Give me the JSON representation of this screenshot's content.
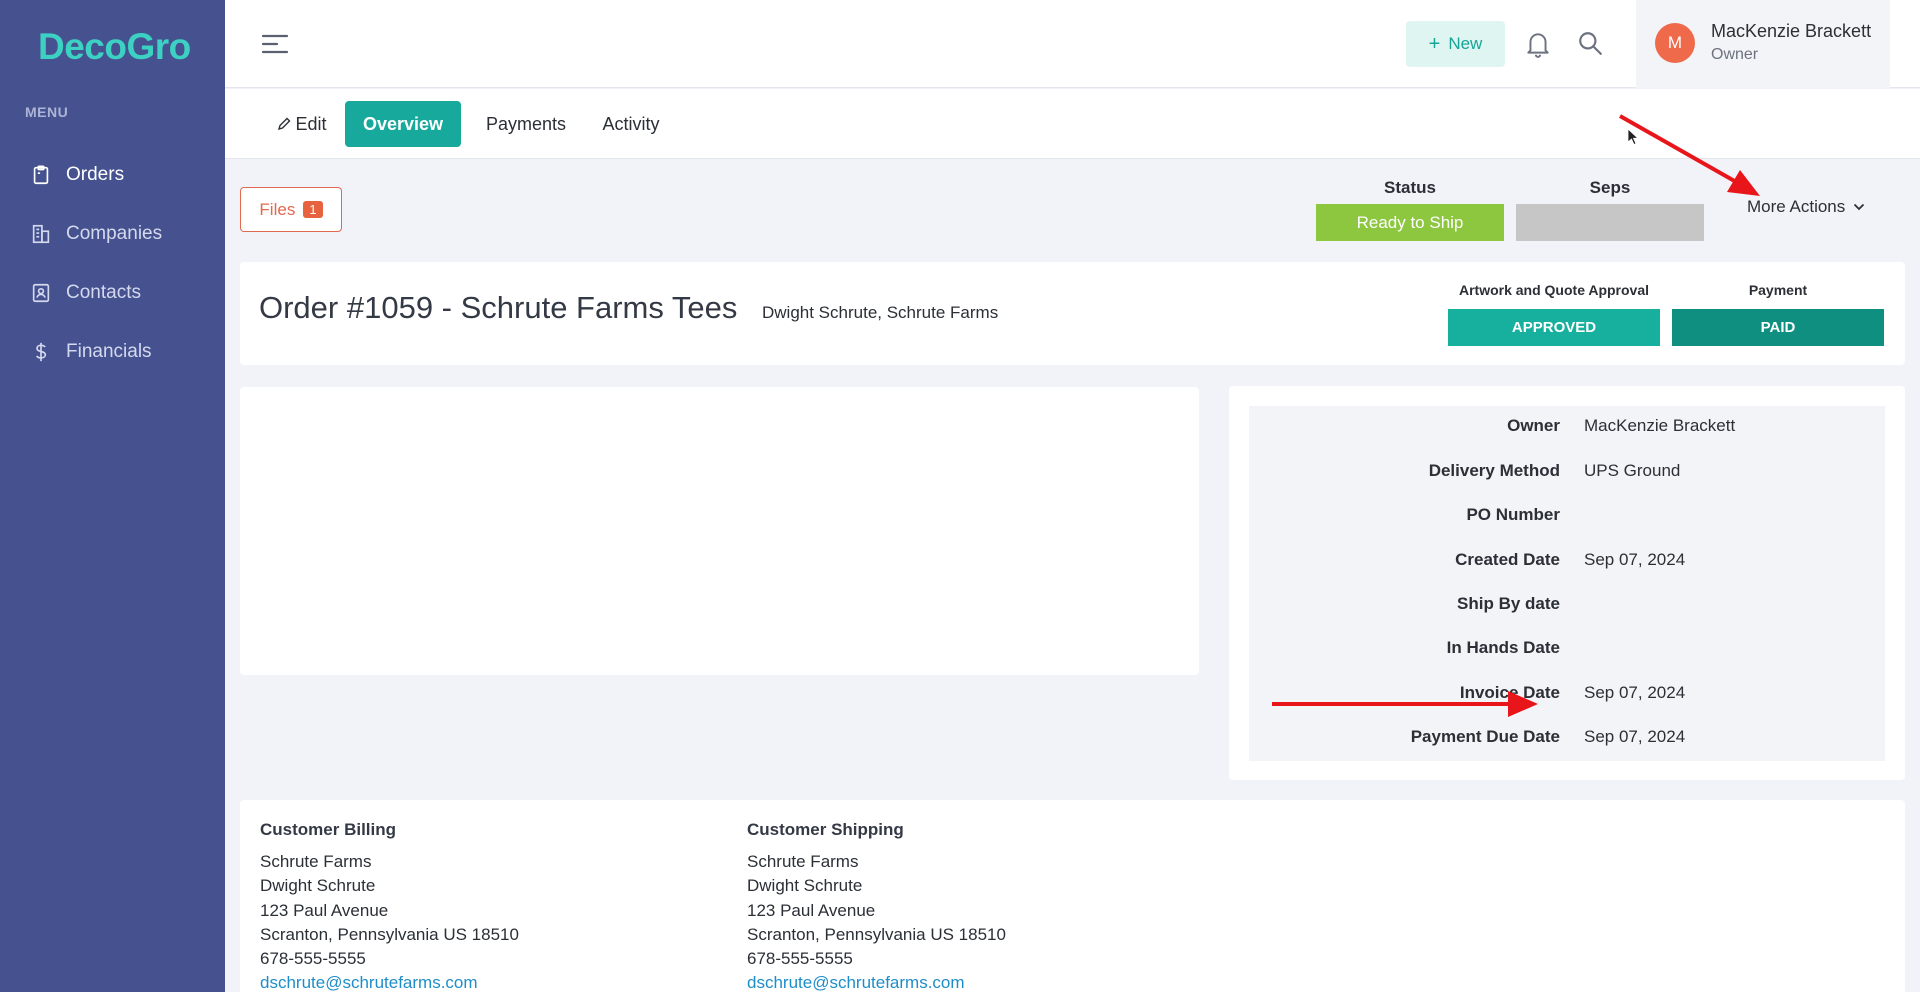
{
  "app": {
    "logo": "DecoGro"
  },
  "sidebar": {
    "menu_label": "MENU",
    "items": [
      {
        "label": "Orders",
        "icon": "clipboard-icon"
      },
      {
        "label": "Companies",
        "icon": "building-icon"
      },
      {
        "label": "Contacts",
        "icon": "contact-card-icon"
      },
      {
        "label": "Financials",
        "icon": "dollar-icon"
      }
    ]
  },
  "topbar": {
    "new_label": "New",
    "user": {
      "initial": "M",
      "name": "MacKenzie Brackett",
      "role": "Owner"
    }
  },
  "tabs": [
    {
      "label": "Edit"
    },
    {
      "label": "Overview"
    },
    {
      "label": "Payments"
    },
    {
      "label": "Activity"
    }
  ],
  "actions": {
    "files_label": "Files",
    "files_count": "1",
    "status_label": "Status",
    "status_value": "Ready to Ship",
    "seps_label": "Seps",
    "seps_value": "",
    "more_actions_label": "More Actions"
  },
  "order": {
    "title": "Order #1059 - Schrute Farms Tees",
    "subtitle": "Dwight Schrute, Schrute Farms",
    "approval_label": "Artwork and Quote Approval",
    "approval_value": "APPROVED",
    "payment_label": "Payment",
    "payment_value": "PAID"
  },
  "details": [
    {
      "label": "Owner",
      "value": "MacKenzie Brackett"
    },
    {
      "label": "Delivery Method",
      "value": "UPS Ground"
    },
    {
      "label": "PO Number",
      "value": ""
    },
    {
      "label": "Created Date",
      "value": "Sep 07, 2024"
    },
    {
      "label": "Ship By date",
      "value": ""
    },
    {
      "label": "In Hands Date",
      "value": ""
    },
    {
      "label": "Invoice Date",
      "value": "Sep 07, 2024"
    },
    {
      "label": "Payment Due Date",
      "value": "Sep 07, 2024"
    }
  ],
  "billing": {
    "title": "Customer Billing",
    "lines": [
      "Schrute Farms",
      "Dwight Schrute",
      "123 Paul Avenue",
      "Scranton, Pennsylvania US 18510",
      "678-555-5555"
    ],
    "email": "dschrute@schrutefarms.com"
  },
  "shipping": {
    "title": "Customer Shipping",
    "lines": [
      "Schrute Farms",
      "Dwight Schrute",
      "123 Paul Avenue",
      "Scranton, Pennsylvania US 18510",
      "678-555-5555"
    ],
    "email": "dschrute@schrutefarms.com"
  },
  "colors": {
    "sidebar": "#45528f",
    "accent_teal": "#17a99b",
    "status_green": "#8dc63f",
    "seps_gray": "#c6c6c6",
    "approved": "#17b09f",
    "paid": "#0e8f80",
    "annotation_red": "#e8161b"
  }
}
